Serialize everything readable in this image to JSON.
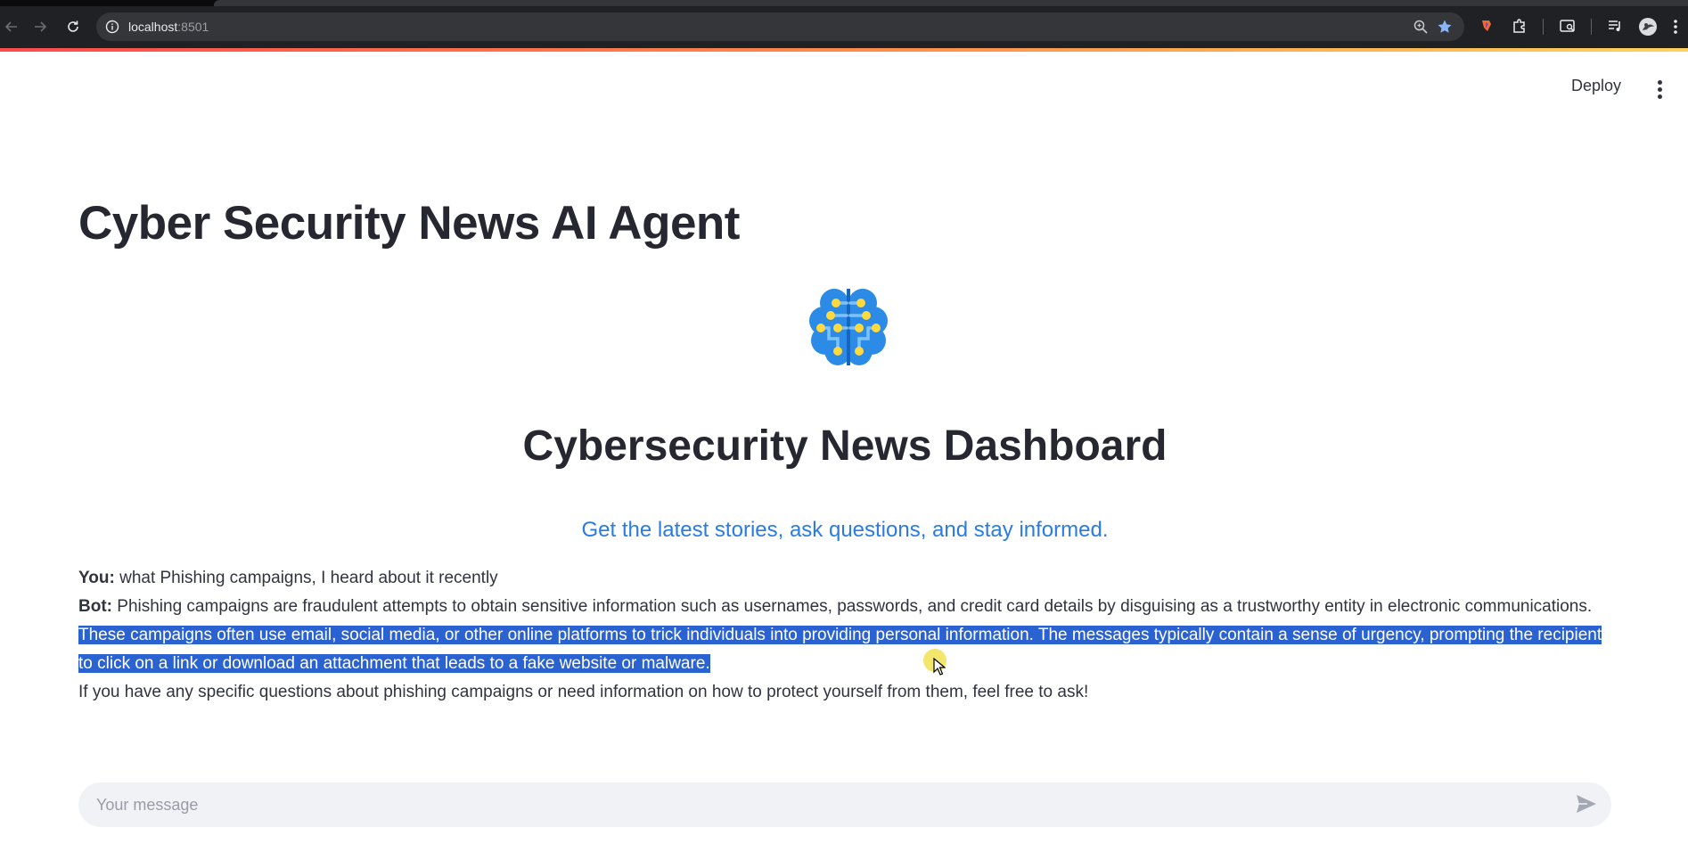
{
  "browser": {
    "url_host": "localhost",
    "url_port": ":8501"
  },
  "header": {
    "deploy_label": "Deploy"
  },
  "app": {
    "title": "Cyber Security News AI Agent",
    "logo_icon": "brain-circuit-icon",
    "dashboard_title": "Cybersecurity News Dashboard",
    "subtitle": "Get the latest stories, ask questions, and stay informed."
  },
  "chat": {
    "user_role": "You:",
    "user_message": "what Phishing campaigns, I heard about it recently",
    "bot_role": "Bot:",
    "bot_paragraph_1": "Phishing campaigns are fraudulent attempts to obtain sensitive information such as usernames, passwords, and credit card details by disguising as a trustworthy entity in electronic communications.",
    "bot_paragraph_2_line_1": "These campaigns often use email, social media, or other online platforms to trick individuals into providing personal information. The messages typically contain a sense of urgency, prompting the recipient",
    "bot_paragraph_2_line_2": "to click on a link or download an attachment that leads to a fake website or malware.",
    "bot_paragraph_3": "If you have any specific questions about phishing campaigns or need information on how to protect yourself from them, feel free to ask!"
  },
  "input": {
    "placeholder": "Your message",
    "value": ""
  },
  "colors": {
    "accent_blue": "#2a7be4",
    "selection": "#2a63d1",
    "text": "#31333f",
    "loadbar_start": "#ff4b4b",
    "loadbar_end": "#ffd15c"
  }
}
